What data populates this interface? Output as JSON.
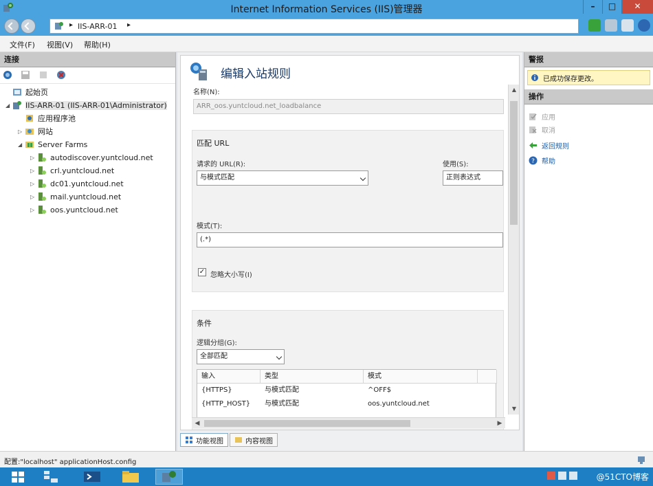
{
  "window": {
    "title": "Internet Information Services (IIS)管理器"
  },
  "address": {
    "crumb": "IIS-ARR-01"
  },
  "menu": [
    "文件(F)",
    "视图(V)",
    "帮助(H)"
  ],
  "left": {
    "header": "连接",
    "tree": [
      {
        "label": "起始页",
        "level": 0,
        "expander": "",
        "icon": "start-page-icon"
      },
      {
        "label": "IIS-ARR-01 (IIS-ARR-01\\Administrator)",
        "level": 0,
        "expander": "◢",
        "icon": "server-icon"
      },
      {
        "label": "应用程序池",
        "level": 1,
        "expander": "",
        "icon": "app-pool-icon"
      },
      {
        "label": "网站",
        "level": 1,
        "expander": "▷",
        "icon": "sites-icon"
      },
      {
        "label": "Server Farms",
        "level": 1,
        "expander": "◢",
        "icon": "server-farms-icon"
      },
      {
        "label": "autodiscover.yuntcloud.net",
        "level": 2,
        "expander": "▷",
        "icon": "farm-icon"
      },
      {
        "label": "crl.yuntcloud.net",
        "level": 2,
        "expander": "▷",
        "icon": "farm-icon"
      },
      {
        "label": "dc01.yuntcloud.net",
        "level": 2,
        "expander": "▷",
        "icon": "farm-icon"
      },
      {
        "label": "mail.yuntcloud.net",
        "level": 2,
        "expander": "▷",
        "icon": "farm-icon"
      },
      {
        "label": "oos.yuntcloud.net",
        "level": 2,
        "expander": "▷",
        "icon": "farm-icon"
      }
    ]
  },
  "editor": {
    "heading": "编辑入站规则",
    "name_label": "名称(N):",
    "name_value": "ARR_oos.yuntcloud.net_loadbalance",
    "match_url": {
      "title": "匹配 URL",
      "requested_label": "请求的 URL(R):",
      "requested_value": "与模式匹配",
      "using_label": "使用(S):",
      "using_value": "正则表达式",
      "pattern_label": "模式(T):",
      "pattern_value": "(.*)",
      "ignore_case_label": "忽略大小写(I)",
      "ignore_case_checked": "✓"
    },
    "conditions": {
      "title": "条件",
      "grouping_label": "逻辑分组(G):",
      "grouping_value": "全部匹配",
      "columns": [
        "输入",
        "类型",
        "模式"
      ],
      "rows": [
        [
          "{HTTPS}",
          "与模式匹配",
          "^OFF$"
        ],
        [
          "{HTTP_HOST}",
          "与模式匹配",
          "oos.yuntcloud.net"
        ]
      ]
    }
  },
  "view_tabs": [
    "功能视图",
    "内容视图"
  ],
  "right": {
    "alerts_header": "警报",
    "alert_text": "已成功保存更改。",
    "actions_header": "操作",
    "actions": [
      {
        "label": "应用",
        "enabled": false,
        "icon": "apply-icon"
      },
      {
        "label": "取消",
        "enabled": false,
        "icon": "cancel-icon"
      },
      {
        "label": "返回规则",
        "enabled": true,
        "icon": "back-arrow-icon"
      },
      {
        "label": "帮助",
        "enabled": true,
        "icon": "help-icon"
      }
    ]
  },
  "status": {
    "text": "配置:\"localhost\" applicationHost.config"
  },
  "taskbar": {
    "watermark": "@51CTO博客"
  },
  "colors": {
    "titlebar": "#4aa3df",
    "taskbar": "#1f7fc4",
    "link": "#1c5ea8",
    "alert_bg": "#fff6c4"
  }
}
